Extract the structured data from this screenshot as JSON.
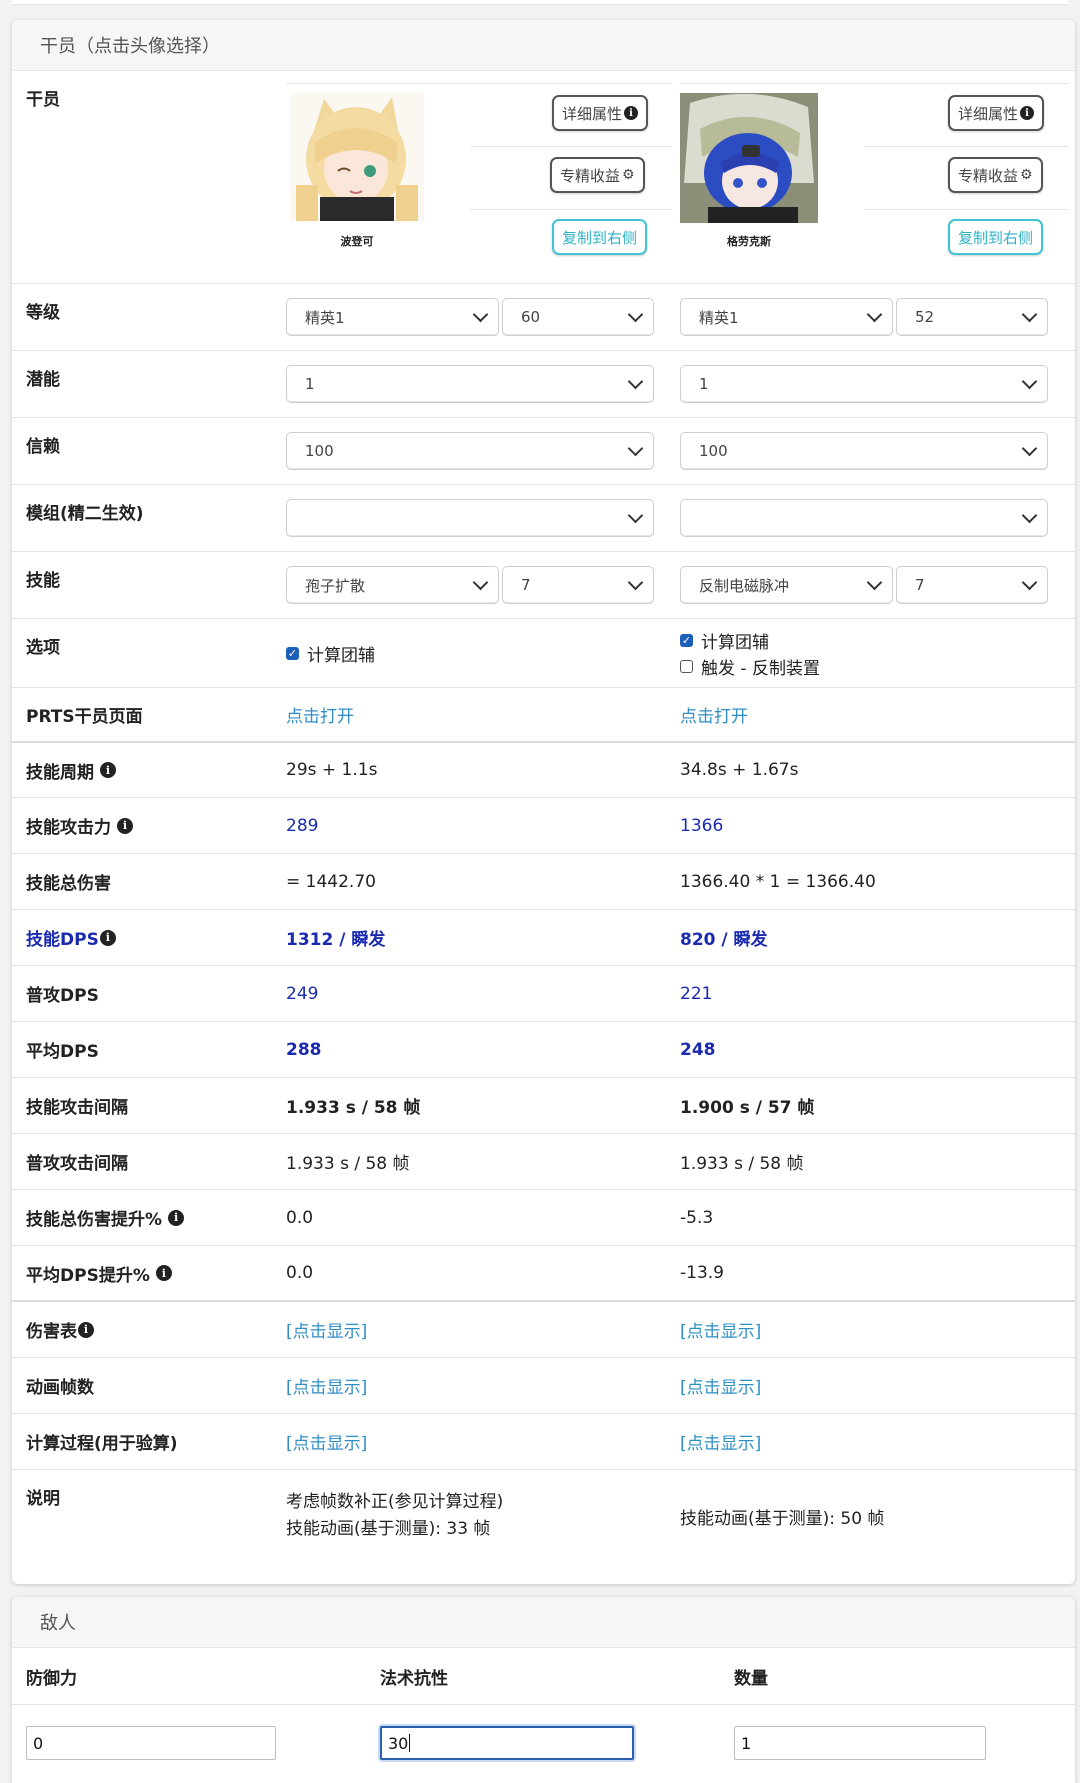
{
  "operators_section": {
    "header": "干员（点击头像选择）",
    "label": "干员",
    "detail_button": "详细属性",
    "mastery_button": "专精收益",
    "copy_button": "复制到右侧",
    "left": {
      "name": "波登可"
    },
    "right": {
      "name": "格劳克斯"
    }
  },
  "rows": {
    "level": {
      "label": "等级",
      "left": [
        "精英1",
        "60"
      ],
      "right": [
        "精英1",
        "52"
      ]
    },
    "potential": {
      "label": "潜能",
      "left": "1",
      "right": "1"
    },
    "trust": {
      "label": "信赖",
      "left": "100",
      "right": "100"
    },
    "module": {
      "label": "模组(精二生效)",
      "left": "",
      "right": ""
    },
    "skill": {
      "label": "技能",
      "left": [
        "孢子扩散",
        "7"
      ],
      "right": [
        "反制电磁脉冲",
        "7"
      ]
    },
    "options": {
      "label": "选项",
      "left": [
        "计算团辅"
      ],
      "right": [
        "计算团辅",
        "触发 - 反制装置"
      ]
    },
    "prts": {
      "label": "PRTS干员页面",
      "left": "点击打开",
      "right": "点击打开"
    },
    "skill_cycle": {
      "label": "技能周期",
      "left": "29s + 1.1s",
      "right": "34.8s + 1.67s"
    },
    "skill_atk": {
      "label": "技能攻击力",
      "left": "289",
      "right": "1366"
    },
    "skill_total": {
      "label": "技能总伤害",
      "left": "= 1442.70",
      "right": "1366.40 * 1 = 1366.40"
    },
    "skill_dps": {
      "label": "技能DPS",
      "left": "1312 / 瞬发",
      "right": "820 / 瞬发"
    },
    "normal_dps": {
      "label": "普攻DPS",
      "left": "249",
      "right": "221"
    },
    "avg_dps": {
      "label": "平均DPS",
      "left": "288",
      "right": "248"
    },
    "skill_interval": {
      "label": "技能攻击间隔",
      "left": "1.933 s / 58 帧",
      "right": "1.900 s / 57 帧"
    },
    "normal_interval": {
      "label": "普攻攻击间隔",
      "left": "1.933 s / 58 帧",
      "right": "1.933 s / 58 帧"
    },
    "skill_total_pct": {
      "label": "技能总伤害提升%",
      "left": "0.0",
      "right": "-5.3"
    },
    "avg_dps_pct": {
      "label": "平均DPS提升%",
      "left": "0.0",
      "right": "-13.9"
    },
    "damage_table": {
      "label": "伤害表",
      "left": "[点击显示]",
      "right": "[点击显示]"
    },
    "anim_frames": {
      "label": "动画帧数",
      "left": "[点击显示]",
      "right": "[点击显示]"
    },
    "calc_process": {
      "label": "计算过程(用于验算)",
      "left": "[点击显示]",
      "right": "[点击显示]"
    },
    "notes": {
      "label": "说明",
      "left": [
        "考虑帧数补正(参见计算过程)",
        "技能动画(基于测量): 33 帧"
      ],
      "right": [
        "技能动画(基于测量): 50 帧"
      ]
    }
  },
  "enemy_section": {
    "header": "敌人",
    "defense": {
      "label": "防御力",
      "value": "0"
    },
    "res": {
      "label": "法术抗性",
      "value": "30"
    },
    "count": {
      "label": "数量",
      "value": "1"
    }
  }
}
